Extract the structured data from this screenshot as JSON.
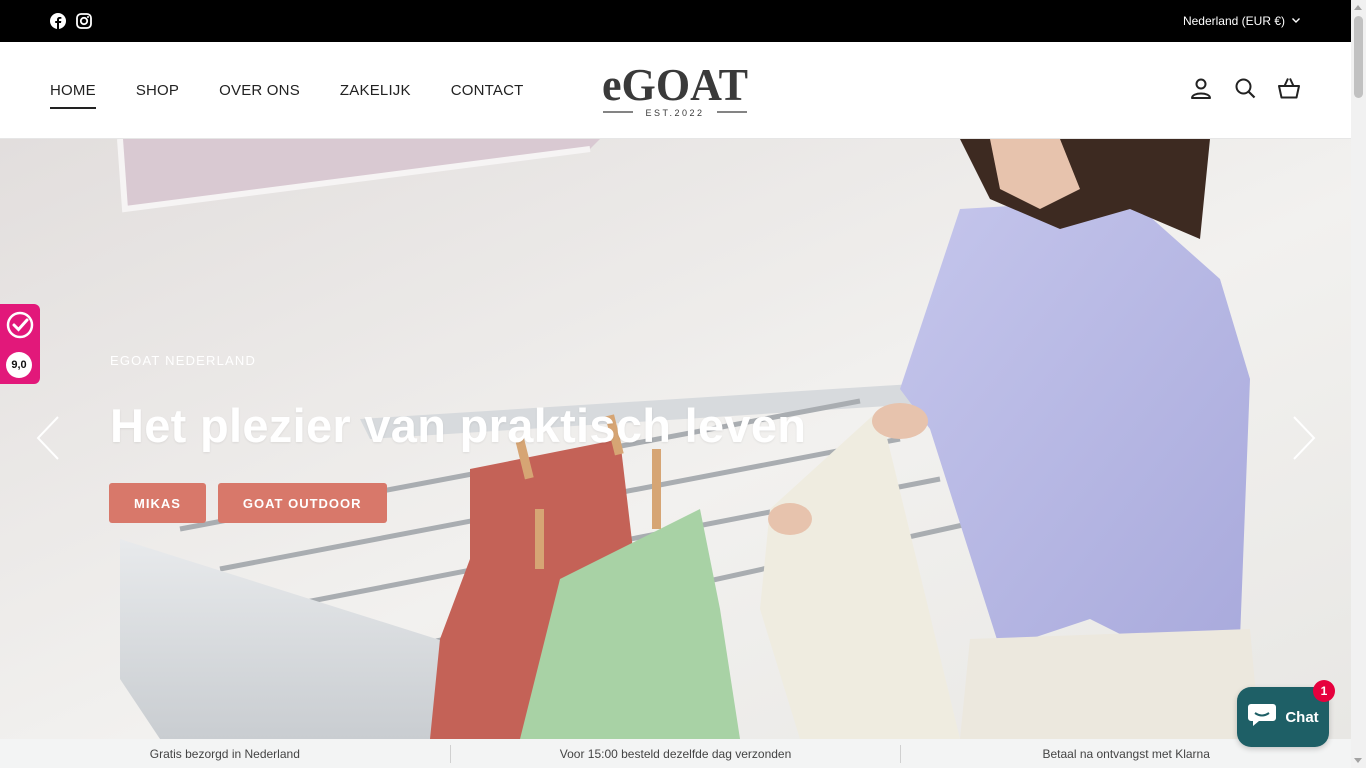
{
  "topbar": {
    "socials": [
      {
        "icon": "facebook-icon"
      },
      {
        "icon": "instagram-icon"
      }
    ],
    "country_selector": "Nederland (EUR €)",
    "country_chevron": "chevron-down-icon"
  },
  "header": {
    "nav": [
      {
        "label": "HOME",
        "active": true
      },
      {
        "label": "SHOP",
        "active": false
      },
      {
        "label": "OVER ONS",
        "active": false
      },
      {
        "label": "ZAKELIJK",
        "active": false
      },
      {
        "label": "CONTACT",
        "active": false
      }
    ],
    "logo": {
      "brand": "eGOAT",
      "tagline": "EST.2022"
    },
    "icons": [
      "account-icon",
      "search-icon",
      "cart-icon"
    ]
  },
  "hero": {
    "eyebrow": "EGOAT NEDERLAND",
    "title": "Het plezier van praktisch leven",
    "buttons": [
      {
        "label": "MIKAS"
      },
      {
        "label": "GOAT OUTDOOR"
      }
    ],
    "accent_color": "#d8786a"
  },
  "rating_badge": {
    "score": "9,0",
    "color": "#e2187a"
  },
  "usp": [
    "Gratis bezorgd in Nederland",
    "Voor 15:00 besteld dezelfde dag verzonden",
    "Betaal na ontvangst met Klarna"
  ],
  "chat": {
    "label": "Chat",
    "badge": "1",
    "color": "#1e5f66"
  }
}
